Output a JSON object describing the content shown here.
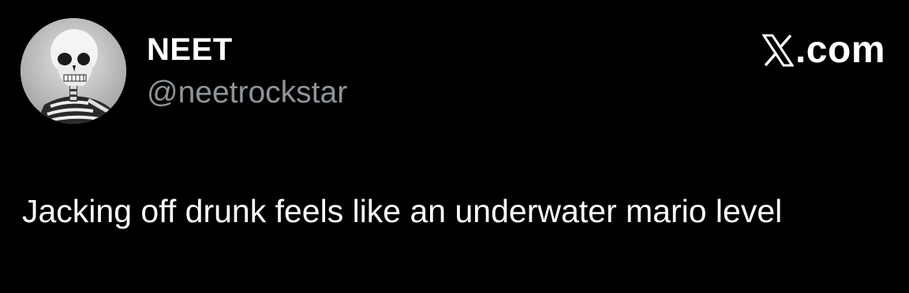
{
  "tweet": {
    "author": {
      "display_name": "NEET",
      "handle": "@neetrockstar",
      "avatar_icon": "skeleton-avatar"
    },
    "brand": {
      "logo_icon": "x-logo-icon",
      "suffix": ".com"
    },
    "text": "Jacking off drunk feels like an underwater mario level"
  },
  "colors": {
    "background": "#000000",
    "text_primary": "#ffffff",
    "text_secondary": "#8f9499"
  }
}
